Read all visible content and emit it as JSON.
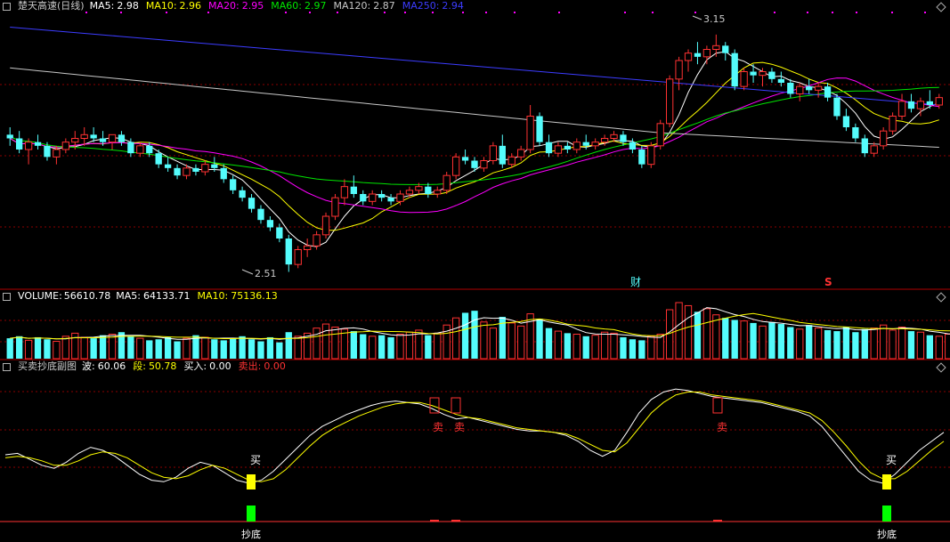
{
  "colors": {
    "up": "#ff3232",
    "down": "#54fcfc",
    "grid": "#8b0000",
    "sep": "#b00000",
    "ma5": "#ffffff",
    "ma10": "#ffff00",
    "ma20": "#ff00ff",
    "ma60": "#00e600",
    "ma120": "#c8c8c8",
    "ma250": "#3c3cff"
  },
  "price_panel": {
    "title": "楚天高速(日线)",
    "legend": [
      {
        "label": "MA5:",
        "value": "2.98",
        "color": "#ffffff"
      },
      {
        "label": "MA10:",
        "value": "2.96",
        "color": "#ffff00"
      },
      {
        "label": "MA20:",
        "value": "2.95",
        "color": "#ff00ff"
      },
      {
        "label": "MA60:",
        "value": "2.97",
        "color": "#00e600"
      },
      {
        "label": "MA120:",
        "value": "2.87",
        "color": "#c8c8c8"
      },
      {
        "label": "MA250:",
        "value": "2.94",
        "color": "#3c3cff"
      }
    ],
    "high_label": "3.15",
    "low_label": "2.51",
    "marker_cai": "财",
    "marker_s": "S",
    "ylim": [
      2.48,
      3.2
    ]
  },
  "volume_panel": {
    "title": "VOLUME:",
    "value": "56610.78",
    "legend": [
      {
        "label": "MA5:",
        "value": "64133.71",
        "color": "#ffffff"
      },
      {
        "label": "MA10:",
        "value": "75136.13",
        "color": "#ffff00"
      }
    ]
  },
  "indicator_panel": {
    "title": "买卖抄底副图",
    "legend": [
      {
        "label": "波:",
        "value": "60.06",
        "color": "#ffffff"
      },
      {
        "label": "段:",
        "value": "50.78",
        "color": "#ffff00"
      },
      {
        "label": "买入:",
        "value": "0.00",
        "color": "#ffffff"
      },
      {
        "label": "卖出:",
        "value": "0.00",
        "color": "#ff3232"
      }
    ],
    "buy_text": "买",
    "sell_text": "卖",
    "bottom_text": "抄底"
  },
  "chart_data": {
    "type": "candlestick",
    "candles": [
      [
        2.88,
        2.9,
        2.85,
        2.87
      ],
      [
        2.87,
        2.89,
        2.83,
        2.84
      ],
      [
        2.84,
        2.87,
        2.8,
        2.86
      ],
      [
        2.86,
        2.88,
        2.84,
        2.85
      ],
      [
        2.85,
        2.86,
        2.81,
        2.82
      ],
      [
        2.82,
        2.85,
        2.8,
        2.84
      ],
      [
        2.84,
        2.87,
        2.83,
        2.86
      ],
      [
        2.86,
        2.89,
        2.84,
        2.87
      ],
      [
        2.87,
        2.9,
        2.85,
        2.88
      ],
      [
        2.88,
        2.9,
        2.86,
        2.87
      ],
      [
        2.87,
        2.89,
        2.85,
        2.86
      ],
      [
        2.86,
        2.88,
        2.84,
        2.88
      ],
      [
        2.88,
        2.89,
        2.85,
        2.86
      ],
      [
        2.86,
        2.87,
        2.82,
        2.83
      ],
      [
        2.83,
        2.86,
        2.82,
        2.85
      ],
      [
        2.85,
        2.86,
        2.82,
        2.83
      ],
      [
        2.83,
        2.84,
        2.79,
        2.8
      ],
      [
        2.8,
        2.82,
        2.78,
        2.79
      ],
      [
        2.79,
        2.8,
        2.76,
        2.77
      ],
      [
        2.77,
        2.8,
        2.76,
        2.79
      ],
      [
        2.79,
        2.8,
        2.77,
        2.78
      ],
      [
        2.78,
        2.81,
        2.77,
        2.8
      ],
      [
        2.8,
        2.82,
        2.78,
        2.79
      ],
      [
        2.79,
        2.8,
        2.75,
        2.76
      ],
      [
        2.76,
        2.77,
        2.72,
        2.73
      ],
      [
        2.73,
        2.74,
        2.7,
        2.71
      ],
      [
        2.71,
        2.72,
        2.67,
        2.68
      ],
      [
        2.68,
        2.69,
        2.64,
        2.65
      ],
      [
        2.65,
        2.66,
        2.62,
        2.63
      ],
      [
        2.63,
        2.64,
        2.59,
        2.6
      ],
      [
        2.6,
        2.61,
        2.51,
        2.53
      ],
      [
        2.53,
        2.58,
        2.52,
        2.57
      ],
      [
        2.57,
        2.6,
        2.55,
        2.58
      ],
      [
        2.58,
        2.62,
        2.57,
        2.61
      ],
      [
        2.61,
        2.67,
        2.6,
        2.66
      ],
      [
        2.66,
        2.72,
        2.65,
        2.71
      ],
      [
        2.71,
        2.76,
        2.69,
        2.74
      ],
      [
        2.74,
        2.77,
        2.71,
        2.72
      ],
      [
        2.72,
        2.73,
        2.69,
        2.7
      ],
      [
        2.7,
        2.73,
        2.69,
        2.72
      ],
      [
        2.72,
        2.73,
        2.7,
        2.71
      ],
      [
        2.71,
        2.72,
        2.69,
        2.7
      ],
      [
        2.7,
        2.73,
        2.69,
        2.72
      ],
      [
        2.72,
        2.74,
        2.71,
        2.73
      ],
      [
        2.73,
        2.75,
        2.72,
        2.74
      ],
      [
        2.74,
        2.75,
        2.71,
        2.72
      ],
      [
        2.72,
        2.74,
        2.71,
        2.73
      ],
      [
        2.73,
        2.78,
        2.72,
        2.77
      ],
      [
        2.77,
        2.83,
        2.76,
        2.82
      ],
      [
        2.82,
        2.84,
        2.8,
        2.81
      ],
      [
        2.81,
        2.82,
        2.78,
        2.79
      ],
      [
        2.79,
        2.82,
        2.78,
        2.81
      ],
      [
        2.81,
        2.86,
        2.8,
        2.85
      ],
      [
        2.85,
        2.88,
        2.79,
        2.8
      ],
      [
        2.8,
        2.83,
        2.79,
        2.82
      ],
      [
        2.82,
        2.85,
        2.81,
        2.84
      ],
      [
        2.84,
        2.96,
        2.83,
        2.93
      ],
      [
        2.93,
        2.94,
        2.85,
        2.86
      ],
      [
        2.86,
        2.88,
        2.82,
        2.83
      ],
      [
        2.83,
        2.86,
        2.82,
        2.85
      ],
      [
        2.85,
        2.86,
        2.83,
        2.84
      ],
      [
        2.84,
        2.87,
        2.83,
        2.86
      ],
      [
        2.86,
        2.88,
        2.84,
        2.85
      ],
      [
        2.85,
        2.87,
        2.84,
        2.86
      ],
      [
        2.86,
        2.88,
        2.85,
        2.87
      ],
      [
        2.87,
        2.89,
        2.86,
        2.88
      ],
      [
        2.88,
        2.89,
        2.85,
        2.86
      ],
      [
        2.86,
        2.87,
        2.83,
        2.84
      ],
      [
        2.84,
        2.85,
        2.79,
        2.8
      ],
      [
        2.8,
        2.86,
        2.79,
        2.85
      ],
      [
        2.85,
        2.92,
        2.84,
        2.91
      ],
      [
        2.91,
        3.04,
        2.9,
        3.03
      ],
      [
        3.03,
        3.09,
        3.0,
        3.08
      ],
      [
        3.08,
        3.11,
        3.05,
        3.1
      ],
      [
        3.1,
        3.13,
        3.07,
        3.09
      ],
      [
        3.09,
        3.12,
        3.07,
        3.11
      ],
      [
        3.11,
        3.15,
        3.09,
        3.12
      ],
      [
        3.12,
        3.13,
        3.08,
        3.1
      ],
      [
        3.1,
        3.11,
        3.0,
        3.01
      ],
      [
        3.01,
        3.06,
        3.0,
        3.05
      ],
      [
        3.05,
        3.07,
        3.02,
        3.04
      ],
      [
        3.04,
        3.06,
        3.01,
        3.05
      ],
      [
        3.05,
        3.06,
        3.02,
        3.03
      ],
      [
        3.03,
        3.05,
        3.01,
        3.02
      ],
      [
        3.02,
        3.03,
        2.98,
        2.99
      ],
      [
        2.99,
        3.02,
        2.97,
        3.01
      ],
      [
        3.01,
        3.03,
        2.99,
        3.0
      ],
      [
        3.0,
        3.02,
        2.98,
        3.01
      ],
      [
        3.01,
        3.02,
        2.97,
        2.98
      ],
      [
        2.98,
        2.99,
        2.92,
        2.93
      ],
      [
        2.93,
        2.95,
        2.89,
        2.9
      ],
      [
        2.9,
        2.91,
        2.86,
        2.87
      ],
      [
        2.87,
        2.88,
        2.82,
        2.83
      ],
      [
        2.83,
        2.86,
        2.82,
        2.85
      ],
      [
        2.85,
        2.9,
        2.84,
        2.89
      ],
      [
        2.89,
        2.94,
        2.88,
        2.93
      ],
      [
        2.93,
        2.99,
        2.92,
        2.97
      ],
      [
        2.97,
        2.99,
        2.94,
        2.95
      ],
      [
        2.95,
        2.98,
        2.93,
        2.97
      ],
      [
        2.97,
        3.0,
        2.95,
        2.96
      ],
      [
        2.96,
        2.99,
        2.95,
        2.98
      ]
    ],
    "volume": [
      20,
      22,
      18,
      21,
      19,
      17,
      22,
      25,
      21,
      20,
      23,
      24,
      26,
      22,
      20,
      18,
      19,
      21,
      17,
      20,
      23,
      21,
      19,
      18,
      20,
      22,
      19,
      17,
      21,
      16,
      26,
      22,
      25,
      30,
      34,
      31,
      29,
      27,
      24,
      22,
      23,
      21,
      24,
      26,
      28,
      23,
      25,
      33,
      40,
      45,
      47,
      36,
      30,
      41,
      35,
      32,
      44,
      39,
      30,
      27,
      25,
      24,
      22,
      23,
      26,
      25,
      21,
      19,
      18,
      22,
      24,
      48,
      55,
      52,
      46,
      49,
      43,
      40,
      38,
      37,
      35,
      32,
      36,
      34,
      31,
      29,
      33,
      30,
      28,
      27,
      31,
      26,
      29,
      30,
      33,
      28,
      31,
      27,
      26,
      23,
      22,
      24,
      25
    ],
    "wave": [
      47,
      48,
      44,
      40,
      38,
      42,
      48,
      52,
      50,
      46,
      40,
      34,
      30,
      29,
      32,
      38,
      42,
      40,
      35,
      30,
      28,
      30,
      36,
      44,
      52,
      60,
      66,
      70,
      74,
      77,
      80,
      82,
      83,
      82,
      81,
      78,
      74,
      71,
      72,
      70,
      68,
      66,
      64,
      63,
      63,
      62,
      60,
      56,
      50,
      46,
      50,
      62,
      75,
      84,
      89,
      91,
      90,
      88,
      86,
      85,
      84,
      83,
      82,
      80,
      78,
      76,
      73,
      66,
      56,
      46,
      36,
      30,
      28,
      34,
      42,
      50,
      56,
      62
    ],
    "segment": [
      45,
      46,
      45,
      43,
      40,
      40,
      43,
      47,
      49,
      48,
      45,
      40,
      35,
      32,
      31,
      33,
      37,
      40,
      38,
      34,
      30,
      29,
      31,
      37,
      45,
      53,
      60,
      65,
      69,
      73,
      76,
      79,
      81,
      82,
      82,
      80,
      77,
      74,
      72,
      71,
      69,
      67,
      65,
      64,
      63,
      62,
      61,
      58,
      54,
      50,
      49,
      55,
      65,
      75,
      82,
      87,
      89,
      89,
      87,
      86,
      85,
      84,
      83,
      81,
      79,
      77,
      75,
      70,
      62,
      53,
      43,
      35,
      31,
      31,
      36,
      43,
      50,
      56
    ]
  }
}
